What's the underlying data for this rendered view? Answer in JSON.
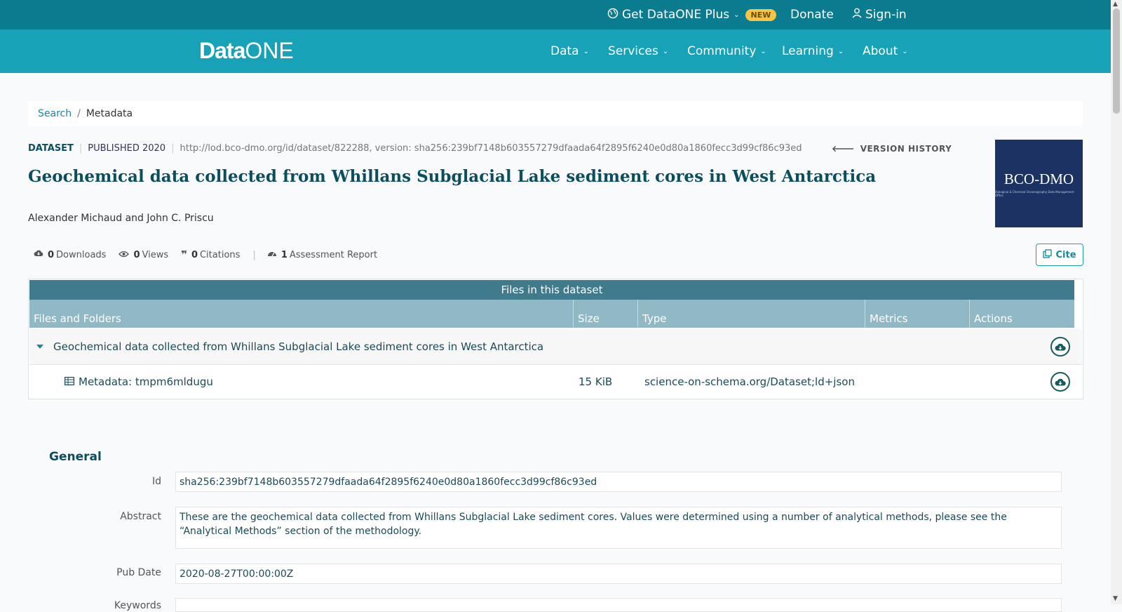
{
  "topbar": {
    "plus_label": "Get DataONE Plus",
    "new_badge": "NEW",
    "donate": "Donate",
    "signin": "Sign-in"
  },
  "nav": {
    "logo_data": "Data",
    "logo_one": "ONE",
    "items": [
      "Data",
      "Services",
      "Community",
      "Learning",
      "About"
    ]
  },
  "breadcrumb": {
    "search": "Search",
    "separator": "/",
    "current": "Metadata"
  },
  "dataset": {
    "type": "DATASET",
    "published": "PUBLISHED 2020",
    "url": "http://lod.bco-dmo.org/id/dataset/822288, version: sha256:239bf7148b603557279dfaada64f2895f6240e0d80a1860fecc3d99cf86c93ed",
    "version_history": "VERSION HISTORY",
    "title": "Geochemical data collected from Whillans Subglacial Lake sediment cores in West Antarctica",
    "authors": "Alexander Michaud and John C. Priscu",
    "logo_text": "BCO-DMO",
    "logo_subtext": "Biological & Chemical Oceanography Data Management Office"
  },
  "metrics": {
    "downloads_count": "0",
    "downloads_label": "Downloads",
    "views_count": "0",
    "views_label": "Views",
    "citations_count": "0",
    "citations_label": "Citations",
    "assessment_count": "1",
    "assessment_label": "Assessment Report",
    "cite": "Cite"
  },
  "files": {
    "header": "Files in this dataset",
    "columns": [
      "Files and Folders",
      "Size",
      "Type",
      "Metrics",
      "Actions"
    ],
    "folder_name": "Geochemical data collected from Whillans Subglacial Lake sediment cores in West Antarctica",
    "file_name": "Metadata: tmpm6mldugu",
    "file_size": "15 KiB",
    "file_type": "science-on-schema.org/Dataset;ld+json"
  },
  "general": {
    "title": "General",
    "id_label": "Id",
    "id_value": "sha256:239bf7148b603557279dfaada64f2895f6240e0d80a1860fecc3d99cf86c93ed",
    "abstract_label": "Abstract",
    "abstract_value": "These are the geochemical data collected from Whillans Subglacial Lake sediment cores. Values were determined using a number of analytical methods, please see the “Analytical Methods” section of the methodology.",
    "pubdate_label": "Pub Date",
    "pubdate_value": "2020-08-27T00:00:00Z",
    "keywords_label": "Keywords"
  },
  "colors": {
    "topbar": "#0b7b8f",
    "nav": "#17a2b8",
    "title": "#0b4f5e"
  },
  "icons": [
    "globe-icon",
    "user-icon",
    "cloud-download-icon",
    "eye-icon",
    "quote-icon",
    "gauge-icon",
    "copy-icon",
    "caret-down-icon",
    "table-icon",
    "arrow-left-icon"
  ]
}
